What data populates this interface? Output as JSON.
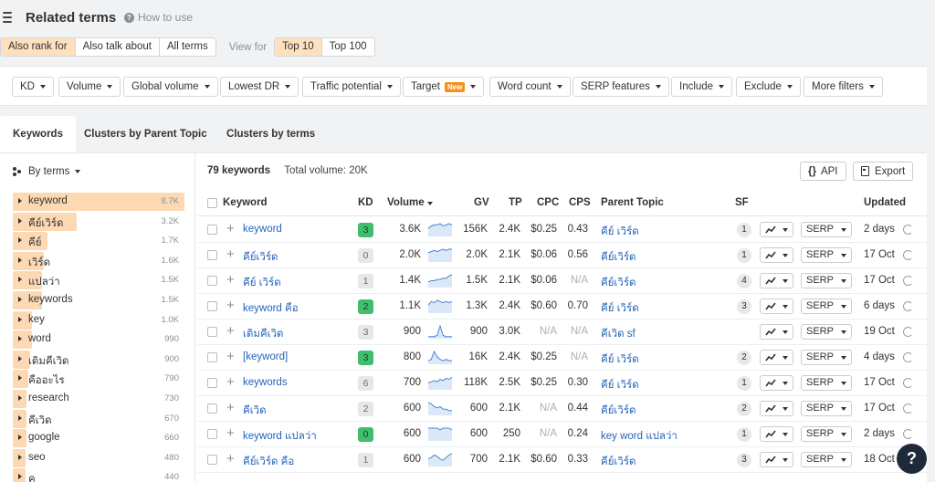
{
  "header": {
    "title": "Related terms",
    "how_to_use": "How to use"
  },
  "modes": {
    "items": [
      {
        "label": "Also rank for",
        "active": true
      },
      {
        "label": "Also talk about",
        "active": false
      },
      {
        "label": "All terms",
        "active": false
      }
    ],
    "view_for_label": "View for",
    "view_for": [
      {
        "label": "Top 10",
        "active": true
      },
      {
        "label": "Top 100",
        "active": false
      }
    ]
  },
  "filters": {
    "kd": "KD",
    "volume": "Volume",
    "global_volume": "Global volume",
    "lowest_dr": "Lowest DR",
    "traffic_potential": "Traffic potential",
    "target": "Target",
    "target_badge": "New",
    "word_count": "Word count",
    "serp_features": "SERP features",
    "include": "Include",
    "exclude": "Exclude",
    "more_filters": "More filters"
  },
  "tabs": {
    "keywords": "Keywords",
    "clusters_parent": "Clusters by Parent Topic",
    "clusters_terms": "Clusters by terms"
  },
  "sidebar": {
    "by_terms": "By terms",
    "items": [
      {
        "label": "keyword",
        "count": "8.7K",
        "share": 1.0
      },
      {
        "label": "คีย์เวิร์ด",
        "count": "3.2K",
        "share": 0.37
      },
      {
        "label": "คีย์",
        "count": "1.7K",
        "share": 0.2
      },
      {
        "label": "เวิร์ด",
        "count": "1.6K",
        "share": 0.18
      },
      {
        "label": "แปลว่า",
        "count": "1.5K",
        "share": 0.17
      },
      {
        "label": "keywords",
        "count": "1.5K",
        "share": 0.17
      },
      {
        "label": "key",
        "count": "1.0K",
        "share": 0.11
      },
      {
        "label": "word",
        "count": "990",
        "share": 0.11
      },
      {
        "label": "เดิมคีเวิด",
        "count": "900",
        "share": 0.1
      },
      {
        "label": "คืออะไร",
        "count": "790",
        "share": 0.09
      },
      {
        "label": "research",
        "count": "730",
        "share": 0.08
      },
      {
        "label": "คีเวิด",
        "count": "670",
        "share": 0.08
      },
      {
        "label": "google",
        "count": "660",
        "share": 0.08
      },
      {
        "label": "seo",
        "count": "480",
        "share": 0.06
      },
      {
        "label": "ค",
        "count": "440",
        "share": 0.05
      }
    ]
  },
  "summary": {
    "count": "79 keywords",
    "total_volume": "Total volume: 20K"
  },
  "actions": {
    "api": "API",
    "export": "Export"
  },
  "columns": {
    "keyword": "Keyword",
    "kd": "KD",
    "volume": "Volume",
    "gv": "GV",
    "tp": "TP",
    "cpc": "CPC",
    "cps": "CPS",
    "parent_topic": "Parent Topic",
    "sf": "SF",
    "updated": "Updated"
  },
  "colors": {
    "kd_green": "#3fbf6b",
    "kd_gray": "#e6e7e9",
    "accent": "#fde1bf",
    "link": "#2563b8"
  },
  "rows": [
    {
      "keyword": "keyword",
      "kd": "3",
      "kd_level": "green",
      "volume": "3.6K",
      "spark": [
        6,
        8,
        9,
        9,
        10,
        8,
        9,
        10,
        9
      ],
      "gv": "156K",
      "tp": "2.4K",
      "cpc": "$0.25",
      "cps": "0.43",
      "parent": "คีย์ เวิร์ด",
      "sf": "1",
      "serp": "SERP",
      "updated": "2 days"
    },
    {
      "keyword": "คีย์เวิร์ด",
      "kd": "0",
      "kd_level": "gray",
      "volume": "2.0K",
      "spark": [
        7,
        8,
        9,
        8,
        9,
        10,
        9,
        10,
        10
      ],
      "gv": "2.0K",
      "tp": "2.1K",
      "cpc": "$0.06",
      "cps": "0.56",
      "parent": "คีย์เวิร์ด",
      "sf": "1",
      "serp": "SERP",
      "updated": "17 Oct"
    },
    {
      "keyword": "คีย์ เวิร์ด",
      "kd": "1",
      "kd_level": "gray",
      "volume": "1.4K",
      "spark": [
        4,
        5,
        5,
        6,
        6,
        7,
        7,
        9,
        10
      ],
      "gv": "1.5K",
      "tp": "2.1K",
      "cpc": "$0.06",
      "cps": "N/A",
      "parent": "คีย์เวิร์ด",
      "sf": "4",
      "serp": "SERP",
      "updated": "17 Oct"
    },
    {
      "keyword": "keyword คือ",
      "kd": "2",
      "kd_level": "green",
      "volume": "1.1K",
      "spark": [
        6,
        9,
        8,
        10,
        9,
        8,
        9,
        8,
        9
      ],
      "gv": "1.3K",
      "tp": "2.4K",
      "cpc": "$0.60",
      "cps": "0.70",
      "parent": "คีย์ เวิร์ด",
      "sf": "3",
      "serp": "SERP",
      "updated": "6 days"
    },
    {
      "keyword": "เติมคีเวิด",
      "kd": "3",
      "kd_level": "gray",
      "volume": "900",
      "spark": [
        1,
        1,
        1,
        2,
        10,
        2,
        1,
        1,
        1
      ],
      "gv": "900",
      "tp": "3.0K",
      "cpc": "N/A",
      "cps": "N/A",
      "parent": "คีเวิด sf",
      "sf": "",
      "serp": "SERP",
      "updated": "19 Oct"
    },
    {
      "keyword": "[keyword]",
      "kd": "3",
      "kd_level": "green",
      "volume": "800",
      "spark": [
        2,
        3,
        9,
        5,
        3,
        2,
        3,
        2,
        2
      ],
      "gv": "16K",
      "tp": "2.4K",
      "cpc": "$0.25",
      "cps": "N/A",
      "parent": "คีย์ เวิร์ด",
      "sf": "2",
      "serp": "SERP",
      "updated": "4 days"
    },
    {
      "keyword": "keywords",
      "kd": "6",
      "kd_level": "gray",
      "volume": "700",
      "spark": [
        5,
        6,
        7,
        6,
        8,
        7,
        9,
        8,
        10
      ],
      "gv": "118K",
      "tp": "2.5K",
      "cpc": "$0.25",
      "cps": "0.30",
      "parent": "คีย์ เวิร์ด",
      "sf": "1",
      "serp": "SERP",
      "updated": "17 Oct"
    },
    {
      "keyword": "คีเวิด",
      "kd": "2",
      "kd_level": "gray",
      "volume": "600",
      "spark": [
        9,
        8,
        6,
        5,
        6,
        4,
        4,
        3,
        3
      ],
      "gv": "600",
      "tp": "2.1K",
      "cpc": "N/A",
      "cps": "0.44",
      "parent": "คีย์เวิร์ด",
      "sf": "2",
      "serp": "SERP",
      "updated": "17 Oct"
    },
    {
      "keyword": "keyword แปลว่า",
      "kd": "0",
      "kd_level": "green",
      "volume": "600",
      "spark": [
        7,
        7,
        7,
        7,
        6,
        7,
        7,
        7,
        6
      ],
      "gv": "600",
      "tp": "250",
      "cpc": "N/A",
      "cps": "0.24",
      "parent": "key word แปลว่า",
      "sf": "1",
      "serp": "SERP",
      "updated": "2 days"
    },
    {
      "keyword": "คีย์เวิร์ด คือ",
      "kd": "1",
      "kd_level": "gray",
      "volume": "600",
      "spark": [
        5,
        6,
        8,
        7,
        5,
        4,
        6,
        8,
        9
      ],
      "gv": "700",
      "tp": "2.1K",
      "cpc": "$0.60",
      "cps": "0.33",
      "parent": "คีย์เวิร์ด",
      "sf": "3",
      "serp": "SERP",
      "updated": "18 Oct"
    }
  ]
}
